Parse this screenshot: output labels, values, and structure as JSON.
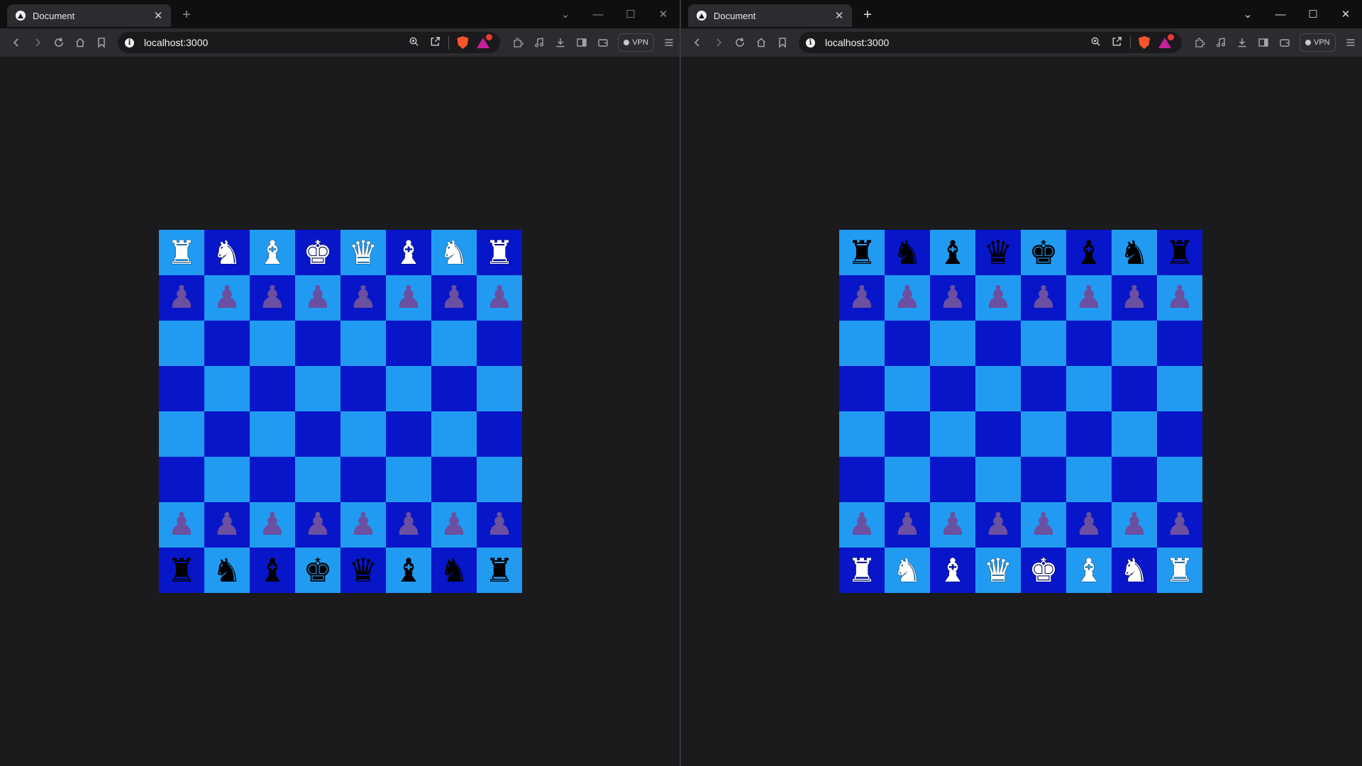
{
  "windows": [
    {
      "tab_title": "Document",
      "tab_close": "✕",
      "new_tab": "+",
      "url": "localhost:3000",
      "vpn_label": "VPN",
      "board": [
        [
          "♜",
          "♞",
          "♝",
          "♚",
          "♛",
          "♝",
          "♞",
          "♜"
        ],
        [
          "♟",
          "♟",
          "♟",
          "♟",
          "♟",
          "♟",
          "♟",
          "♟"
        ],
        [
          "",
          "",
          "",
          "",
          "",
          "",
          "",
          ""
        ],
        [
          "",
          "",
          "",
          "",
          "",
          "",
          "",
          ""
        ],
        [
          "",
          "",
          "",
          "",
          "",
          "",
          "",
          ""
        ],
        [
          "",
          "",
          "",
          "",
          "",
          "",
          "",
          ""
        ],
        [
          "♟",
          "♟",
          "♟",
          "♟",
          "♟",
          "♟",
          "♟",
          "♟"
        ],
        [
          "♜",
          "♞",
          "♝",
          "♚",
          "♛",
          "♝",
          "♞",
          "♜"
        ]
      ],
      "piece_colors": [
        [
          "w",
          "w",
          "w",
          "w",
          "w",
          "w",
          "w",
          "w"
        ],
        [
          "p",
          "p",
          "p",
          "p",
          "p",
          "p",
          "p",
          "p"
        ],
        [
          "",
          "",
          "",
          "",
          "",
          "",
          "",
          ""
        ],
        [
          "",
          "",
          "",
          "",
          "",
          "",
          "",
          ""
        ],
        [
          "",
          "",
          "",
          "",
          "",
          "",
          "",
          ""
        ],
        [
          "",
          "",
          "",
          "",
          "",
          "",
          "",
          ""
        ],
        [
          "p",
          "p",
          "p",
          "p",
          "p",
          "p",
          "p",
          "p"
        ],
        [
          "b",
          "b",
          "b",
          "b",
          "b",
          "b",
          "b",
          "b"
        ]
      ]
    },
    {
      "tab_title": "Document",
      "tab_close": "✕",
      "new_tab": "+",
      "url": "localhost:3000",
      "vpn_label": "VPN",
      "board": [
        [
          "♜",
          "♞",
          "♝",
          "♛",
          "♚",
          "♝",
          "♞",
          "♜"
        ],
        [
          "♟",
          "♟",
          "♟",
          "♟",
          "♟",
          "♟",
          "♟",
          "♟"
        ],
        [
          "",
          "",
          "",
          "",
          "",
          "",
          "",
          ""
        ],
        [
          "",
          "",
          "",
          "",
          "",
          "",
          "",
          ""
        ],
        [
          "",
          "",
          "",
          "",
          "",
          "",
          "",
          ""
        ],
        [
          "",
          "",
          "",
          "",
          "",
          "",
          "",
          ""
        ],
        [
          "♟",
          "♟",
          "♟",
          "♟",
          "♟",
          "♟",
          "♟",
          "♟"
        ],
        [
          "♜",
          "♞",
          "♝",
          "♛",
          "♚",
          "♝",
          "♞",
          "♜"
        ]
      ],
      "piece_colors": [
        [
          "b",
          "b",
          "b",
          "b",
          "b",
          "b",
          "b",
          "b"
        ],
        [
          "p",
          "p",
          "p",
          "p",
          "p",
          "p",
          "p",
          "p"
        ],
        [
          "",
          "",
          "",
          "",
          "",
          "",
          "",
          ""
        ],
        [
          "",
          "",
          "",
          "",
          "",
          "",
          "",
          ""
        ],
        [
          "",
          "",
          "",
          "",
          "",
          "",
          "",
          ""
        ],
        [
          "",
          "",
          "",
          "",
          "",
          "",
          "",
          ""
        ],
        [
          "p",
          "p",
          "p",
          "p",
          "p",
          "p",
          "p",
          "p"
        ],
        [
          "w",
          "w",
          "w",
          "w",
          "w",
          "w",
          "w",
          "w"
        ]
      ]
    }
  ],
  "colors": {
    "light_square": "#219bf2",
    "dark_square": "#0716c8",
    "pawn": "#6b4fa0",
    "white_piece": "#ffffff",
    "black_piece": "#000000"
  },
  "icons": {
    "back": "back-arrow-icon",
    "forward": "forward-arrow-icon",
    "reload": "reload-icon",
    "home": "home-icon",
    "bookmark": "bookmark-icon",
    "zoom": "zoom-icon",
    "share": "share-icon",
    "shields": "brave-shields-icon",
    "rewards": "brave-rewards-icon",
    "extensions": "extensions-icon",
    "media": "media-icon",
    "downloads": "downloads-icon",
    "sidebar": "sidebar-icon",
    "wallet": "wallet-icon",
    "menu": "menu-icon"
  }
}
